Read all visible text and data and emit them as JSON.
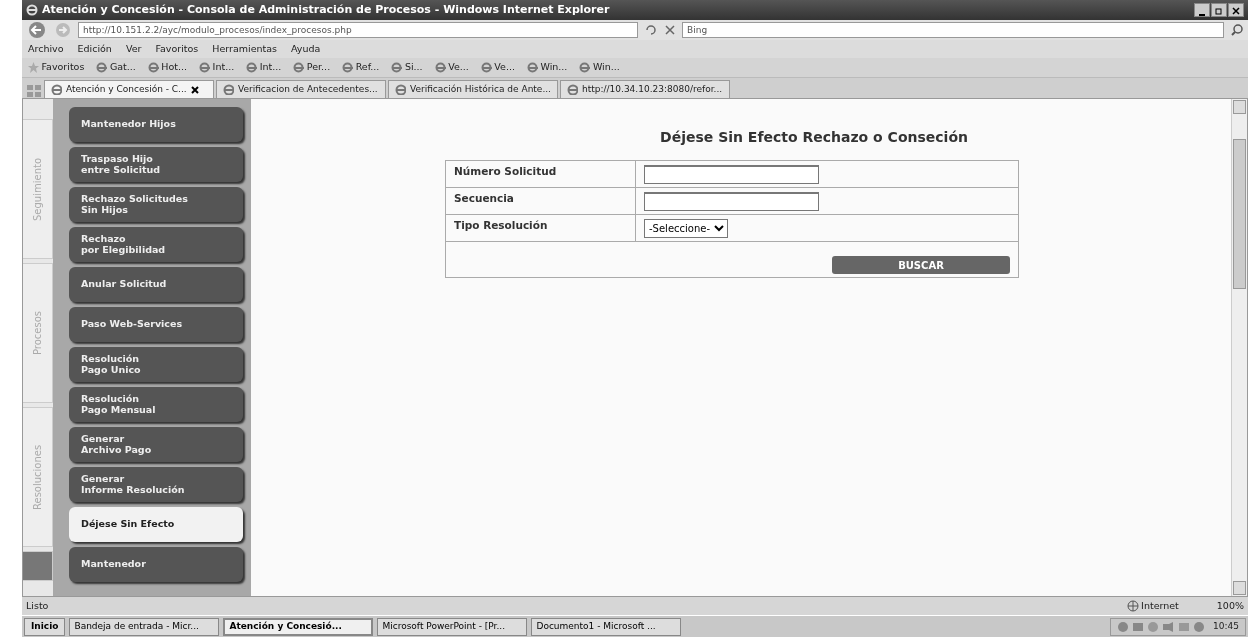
{
  "window": {
    "title": "Atención y Concesión - Consola de Administración de Procesos - Windows Internet Explorer"
  },
  "address": {
    "url": "http://10.151.2.2/ayc/modulo_procesos/index_procesos.php",
    "search_placeholder": "Bing"
  },
  "menu": [
    "Archivo",
    "Edición",
    "Ver",
    "Favoritos",
    "Herramientas",
    "Ayuda"
  ],
  "favorites": {
    "label": "Favoritos",
    "items": [
      "Gat...",
      "Hot...",
      "Int...",
      "Int...",
      "Per...",
      "Ref...",
      "Si...",
      "Ve...",
      "Ve...",
      "Win...",
      "Win..."
    ]
  },
  "tabs": [
    {
      "label": "Atención y Concesión - C...",
      "selected": true
    },
    {
      "label": "Verificacion de Antecedentes...",
      "selected": false
    },
    {
      "label": "Verificación Histórica de Ante...",
      "selected": false
    },
    {
      "label": "http://10.34.10.23:8080/refor...",
      "selected": false
    }
  ],
  "side_tabs": [
    {
      "label": "Seguimiento",
      "selected": false
    },
    {
      "label": "Procesos",
      "selected": false
    },
    {
      "label": "Resoluciones",
      "selected": false
    },
    {
      "selected": true
    }
  ],
  "sidebar": {
    "items": [
      {
        "label": "Mantenedor Hijos",
        "selected": false
      },
      {
        "label": "Traspaso Hijo\nentre Solicitud",
        "selected": false
      },
      {
        "label": "Rechazo Solicitudes\nSin Hijos",
        "selected": false
      },
      {
        "label": "Rechazo\npor Elegibilidad",
        "selected": false
      },
      {
        "label": "Anular Solicitud",
        "selected": false
      },
      {
        "label": "Paso Web-Services",
        "selected": false
      },
      {
        "label": "Resolución\nPago Unico",
        "selected": false
      },
      {
        "label": "Resolución\nPago Mensual",
        "selected": false
      },
      {
        "label": "Generar\nArchivo Pago",
        "selected": false
      },
      {
        "label": "Generar\nInforme Resolución",
        "selected": false
      },
      {
        "label": "Déjese Sin Efecto",
        "selected": true
      },
      {
        "label": "Mantenedor",
        "selected": false
      }
    ]
  },
  "form": {
    "title": "Déjese Sin Efecto Rechazo o Conseción",
    "fields": [
      {
        "label": "Número Solicitud",
        "kind": "text"
      },
      {
        "label": "Secuencia",
        "kind": "text"
      },
      {
        "label": "Tipo Resolución",
        "kind": "select",
        "value": "-Seleccione-"
      }
    ],
    "button": "BUSCAR"
  },
  "status_bar": {
    "text": "Listo",
    "zone": "Internet",
    "zoom": "100%"
  },
  "taskbar": {
    "start": "Inicio",
    "items": [
      {
        "label": "Bandeja de entrada - Micr...",
        "selected": false
      },
      {
        "label": "Atención y Concesió...",
        "selected": true
      },
      {
        "label": "Microsoft PowerPoint - [Pr...",
        "selected": false
      },
      {
        "label": "Documento1 - Microsoft ...",
        "selected": false
      }
    ],
    "clock": "10:45"
  }
}
